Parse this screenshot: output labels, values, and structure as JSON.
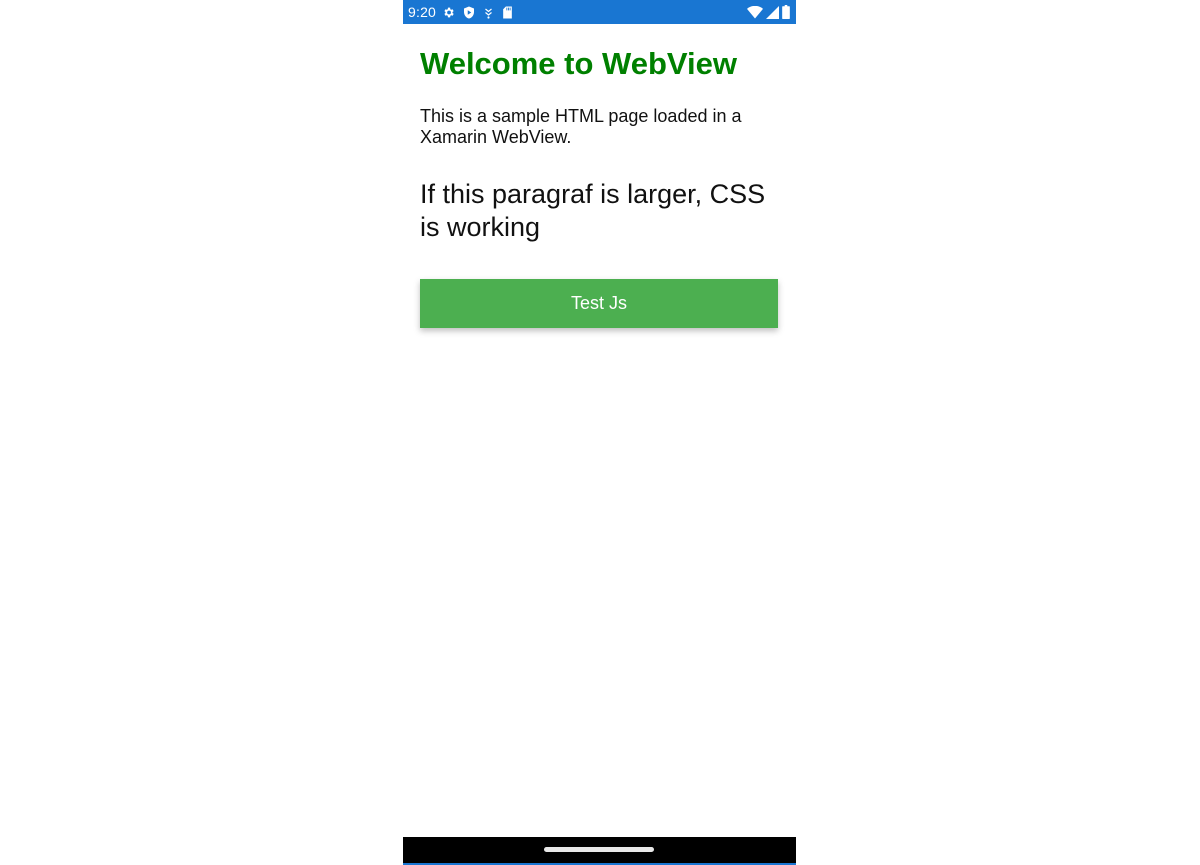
{
  "status_bar": {
    "time": "9:20",
    "background_color": "#1976d2",
    "left_icons": [
      "gear-icon",
      "shield-icon",
      "usb-debug-icon",
      "sd-card-icon"
    ],
    "right_icons": [
      "wifi-icon",
      "signal-icon",
      "battery-icon"
    ]
  },
  "page": {
    "heading": "Welcome to WebView",
    "heading_color": "#008000",
    "intro": "This is a sample HTML page loaded in a Xamarin WebView.",
    "large_paragraph": "If this paragraf is larger, CSS is working",
    "button_label": "Test Js",
    "button_color": "#4caf50"
  },
  "nav_bar": {
    "background_color": "#000000",
    "handle": "gesture-handle"
  }
}
